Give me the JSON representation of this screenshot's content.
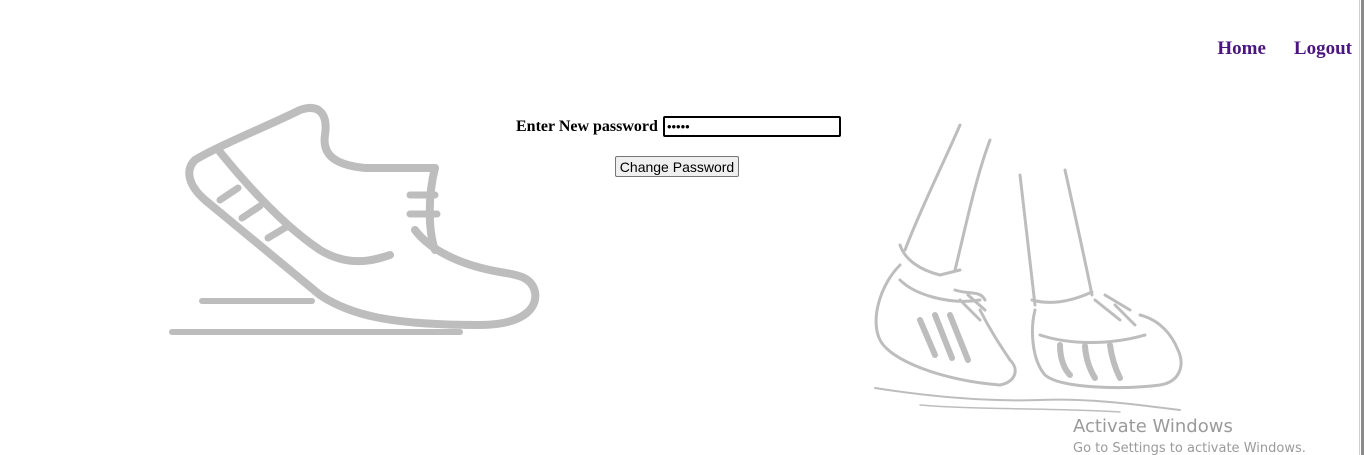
{
  "nav": {
    "home_label": "Home",
    "logout_label": "Logout"
  },
  "form": {
    "label": "Enter New password",
    "password_value": "•••••",
    "button_label": "Change Password"
  },
  "watermark": {
    "title": "Activate Windows",
    "subtitle": "Go to Settings to activate Windows."
  },
  "colors": {
    "nav_link": "#4b1580",
    "illustration": "#bdbdbd"
  },
  "icons": {
    "left_illustration": "running-shoe-icon",
    "right_illustration": "walking-feet-icon"
  }
}
